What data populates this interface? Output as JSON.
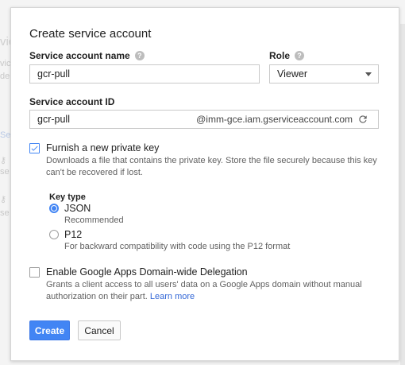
{
  "background": {
    "title_fragment": "vic",
    "line1": "vic",
    "line2": "de",
    "line3": "Se",
    "line4": "se",
    "line5": "se"
  },
  "dialog": {
    "title": "Create service account",
    "service_account_name": {
      "label": "Service account name",
      "value": "gcr-pull"
    },
    "role": {
      "label": "Role",
      "selected": "Viewer"
    },
    "service_account_id": {
      "label": "Service account ID",
      "value": "gcr-pull",
      "domain_suffix": "@imm-gce.iam.gserviceaccount.com"
    },
    "private_key": {
      "checked": true,
      "title": "Furnish a new private key",
      "description": "Downloads a file that contains the private key. Store the file securely because this key can't be recovered if lost."
    },
    "key_type": {
      "label": "Key type",
      "options": [
        {
          "label": "JSON",
          "description": "Recommended",
          "selected": true
        },
        {
          "label": "P12",
          "description": "For backward compatibility with code using the P12 format",
          "selected": false
        }
      ]
    },
    "delegation": {
      "checked": false,
      "title": "Enable Google Apps Domain-wide Delegation",
      "description": "Grants a client access to all users' data on a Google Apps domain without manual authorization on their part.",
      "link": "Learn more"
    },
    "buttons": {
      "create": "Create",
      "cancel": "Cancel"
    }
  },
  "colors": {
    "accent": "#4285f4",
    "link": "#3367d6"
  }
}
